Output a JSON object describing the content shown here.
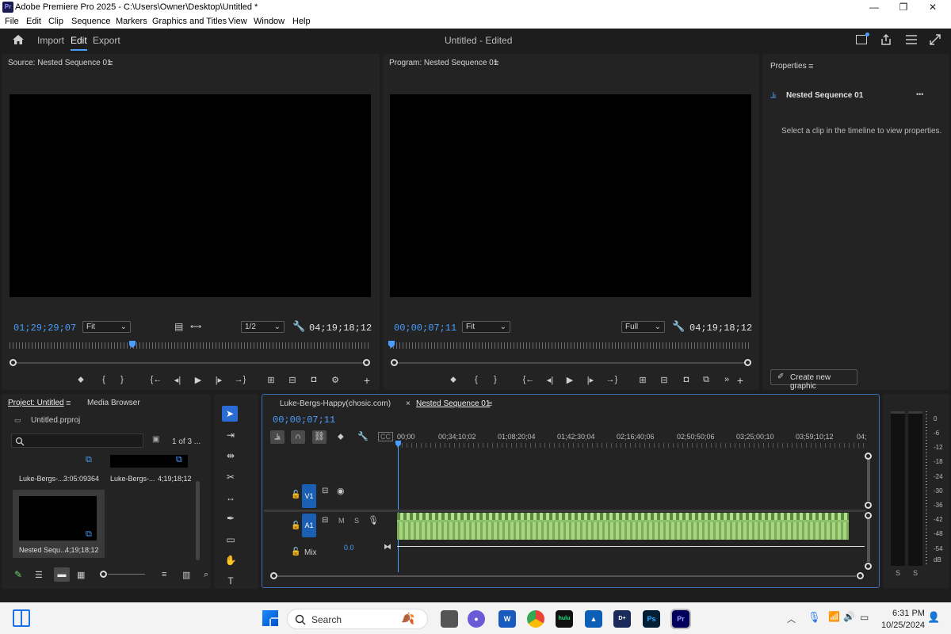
{
  "window": {
    "app_icon": "Pr",
    "title": "Adobe Premiere Pro 2025 - C:\\Users\\Owner\\Desktop\\Untitled *",
    "controls": {
      "minimize": "—",
      "maximize": "❐",
      "close": "✕"
    }
  },
  "menu": [
    "File",
    "Edit",
    "Clip",
    "Sequence",
    "Markers",
    "Graphics and Titles",
    "View",
    "Window",
    "Help"
  ],
  "header": {
    "workspaces": [
      "Import",
      "Edit",
      "Export"
    ],
    "active_workspace": "Edit",
    "project_title": "Untitled - Edited"
  },
  "source": {
    "title": "Source: Nested Sequence 01",
    "timecode": "01;29;29;07",
    "fit": "Fit",
    "resolution": "1/2",
    "duration": "04;19;18;12",
    "playhead_fraction": 0.34
  },
  "program": {
    "title": "Program: Nested Sequence 01",
    "timecode": "00;00;07;11",
    "fit": "Fit",
    "resolution": "Full",
    "duration": "04;19;18;12"
  },
  "properties": {
    "title": "Properties",
    "item": "Nested Sequence 01",
    "more": "•••",
    "message": "Select a clip in the timeline to view properties.",
    "create_graphic": "Create new graphic"
  },
  "project": {
    "tabs": [
      "Project: Untitled",
      "Media Browser"
    ],
    "file": "Untitled.prproj",
    "count": "1 of 3 ...",
    "items": [
      {
        "name": "Luke-Bergs-...",
        "duration": "3:05:09364"
      },
      {
        "name": "Luke-Bergs-...",
        "duration": "4;19;18;12"
      },
      {
        "name": "Nested Sequ...",
        "duration": "4;19;18;12"
      }
    ]
  },
  "timeline": {
    "tabs": [
      "Luke-Bergs-Happy(chosic.com)",
      "Nested Sequence 01"
    ],
    "close_icon": "×",
    "timecode": "00;00;07;11",
    "ruler": [
      "00;00",
      "00;34;10;02",
      "01;08;20;04",
      "01;42;30;04",
      "02;16;40;06",
      "02;50;50;06",
      "03;25;00;10",
      "03;59;10;12",
      "04;"
    ],
    "tracks": {
      "v1": "V1",
      "a1": "A1",
      "mix": "Mix",
      "mix_value": "0.0",
      "mute": "M",
      "solo": "S"
    }
  },
  "meter": {
    "scale": [
      "0",
      "-6",
      "-12",
      "-18",
      "-24",
      "-30",
      "-36",
      "-42",
      "-48",
      "-54",
      "dB"
    ],
    "solo_labels": [
      "S",
      "S"
    ]
  },
  "taskbar": {
    "search": "Search",
    "time": "6:31 PM",
    "date": "10/25/2024",
    "apps": [
      "W",
      "hulu",
      "Ps",
      "Pr"
    ]
  },
  "colors": {
    "accent": "#4a9eff",
    "audio_clip": "#8dc06a",
    "track_button": "#1a5fb4"
  }
}
